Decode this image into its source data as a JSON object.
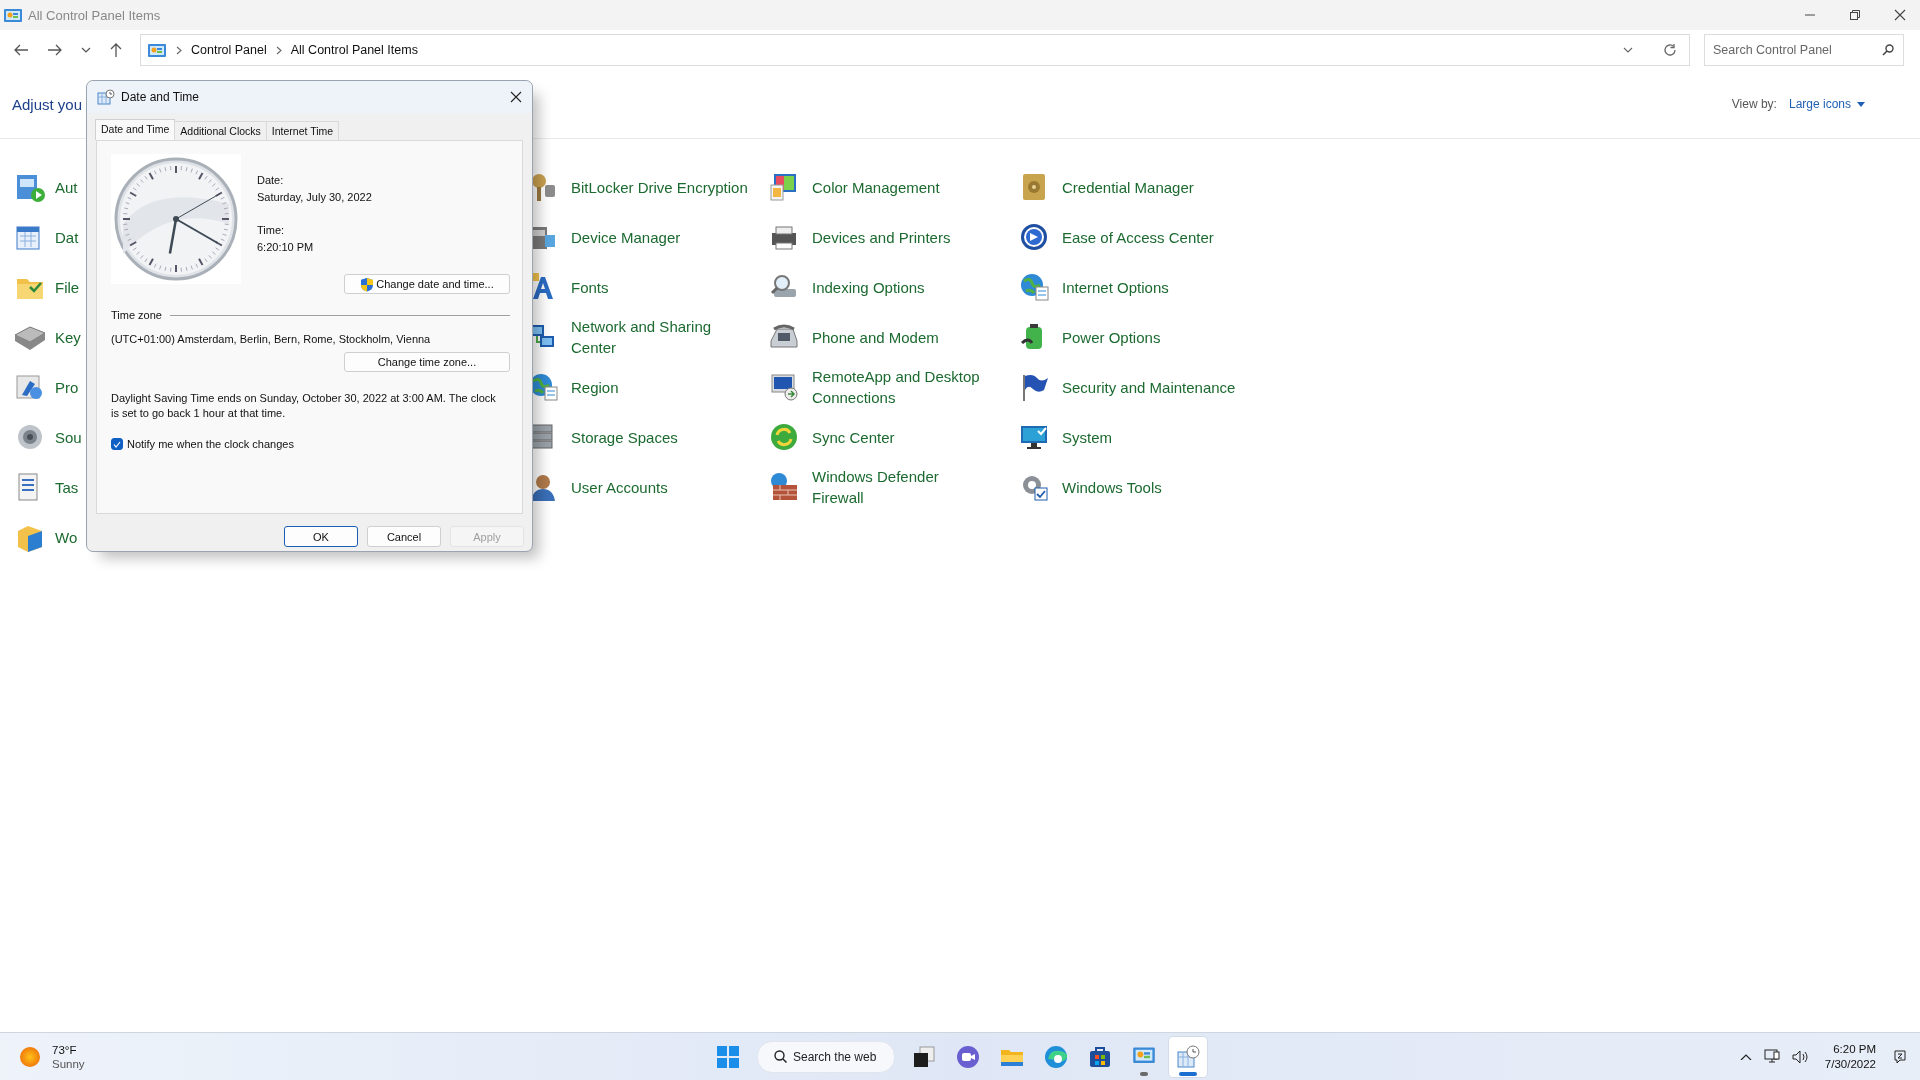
{
  "window": {
    "title": "All Control Panel Items"
  },
  "address_bar": {
    "breadcrumbs": [
      "Control Panel",
      "All Control Panel Items"
    ]
  },
  "search": {
    "placeholder": "Search Control Panel"
  },
  "header": {
    "title": "Adjust you",
    "view_by_label": "View by:",
    "view_by_value": "Large icons"
  },
  "items": [
    {
      "label": "Aut",
      "kind": "autoplay"
    },
    {
      "label": "BitLocker Drive Encryption",
      "kind": "bitlocker"
    },
    {
      "label": "Color Management",
      "kind": "color"
    },
    {
      "label": "Credential Manager",
      "kind": "vault"
    },
    {
      "label": "Dat",
      "kind": "calendar"
    },
    {
      "label": "Device Manager",
      "kind": "device"
    },
    {
      "label": "Devices and Printers",
      "kind": "printer"
    },
    {
      "label": "Ease of Access Center",
      "kind": "access"
    },
    {
      "label": "File",
      "kind": "folder"
    },
    {
      "label": "Fonts",
      "kind": "fonts"
    },
    {
      "label": "Indexing Options",
      "kind": "search"
    },
    {
      "label": "Internet Options",
      "kind": "globe"
    },
    {
      "label": "Key",
      "kind": "keyboard"
    },
    {
      "label": "Network and Sharing Center",
      "kind": "network"
    },
    {
      "label": "Phone and Modem",
      "kind": "phone"
    },
    {
      "label": "Power Options",
      "kind": "battery"
    },
    {
      "label": "Pro",
      "kind": "programs"
    },
    {
      "label": "Region",
      "kind": "globe"
    },
    {
      "label": "RemoteApp and Desktop Connections",
      "kind": "remote"
    },
    {
      "label": "Security and Maintenance",
      "kind": "flag"
    },
    {
      "label": "Sou",
      "kind": "speaker"
    },
    {
      "label": "Storage Spaces",
      "kind": "storage"
    },
    {
      "label": "Sync Center",
      "kind": "sync"
    },
    {
      "label": "System",
      "kind": "monitor"
    },
    {
      "label": "Tas",
      "kind": "taskbar"
    },
    {
      "label": "User Accounts",
      "kind": "user"
    },
    {
      "label": "Windows Defender Firewall",
      "kind": "firewall"
    },
    {
      "label": "Windows Tools",
      "kind": "gear"
    },
    {
      "label": "Wo",
      "kind": "folder3d"
    }
  ],
  "dialog": {
    "title": "Date and Time",
    "tabs": [
      {
        "label": "Date and Time",
        "selected": true
      },
      {
        "label": "Additional Clocks",
        "selected": false
      },
      {
        "label": "Internet Time",
        "selected": false
      }
    ],
    "date_label": "Date:",
    "date_value": "Saturday, July 30, 2022",
    "time_label": "Time:",
    "time_value": "6:20:10 PM",
    "change_datetime_button": "Change date and time...",
    "timezone_group": "Time zone",
    "timezone_value": "(UTC+01:00) Amsterdam, Berlin, Bern, Rome, Stockholm, Vienna",
    "change_timezone_button": "Change time zone...",
    "dst_note": "Daylight Saving Time ends on Sunday, October 30, 2022 at 3:00 AM. The clock is set to go back 1 hour at that time.",
    "notify": {
      "label": "Notify me when the clock changes",
      "checked": true
    },
    "buttons": [
      {
        "label": "OK",
        "kind": "default",
        "disabled": false
      },
      {
        "label": "Cancel",
        "kind": "normal",
        "disabled": false
      },
      {
        "label": "Apply",
        "kind": "normal",
        "disabled": true
      }
    ]
  },
  "taskbar": {
    "weather": {
      "temperature": "73°F",
      "condition": "Sunny"
    },
    "apps": [
      {
        "kind": "start",
        "open": false,
        "selected": false
      },
      {
        "kind": "search",
        "label": "Search the web"
      },
      {
        "kind": "taskview",
        "open": false,
        "selected": false
      },
      {
        "kind": "chat",
        "open": false,
        "selected": false
      },
      {
        "kind": "explorer",
        "open": false,
        "selected": false
      },
      {
        "kind": "edge",
        "open": false,
        "selected": false
      },
      {
        "kind": "store",
        "open": false,
        "selected": false
      },
      {
        "kind": "controlpanel",
        "open": true,
        "selected": false
      },
      {
        "kind": "datetime",
        "open": true,
        "selected": true
      }
    ],
    "time": "6:20 PM",
    "date": "7/30/2022"
  }
}
